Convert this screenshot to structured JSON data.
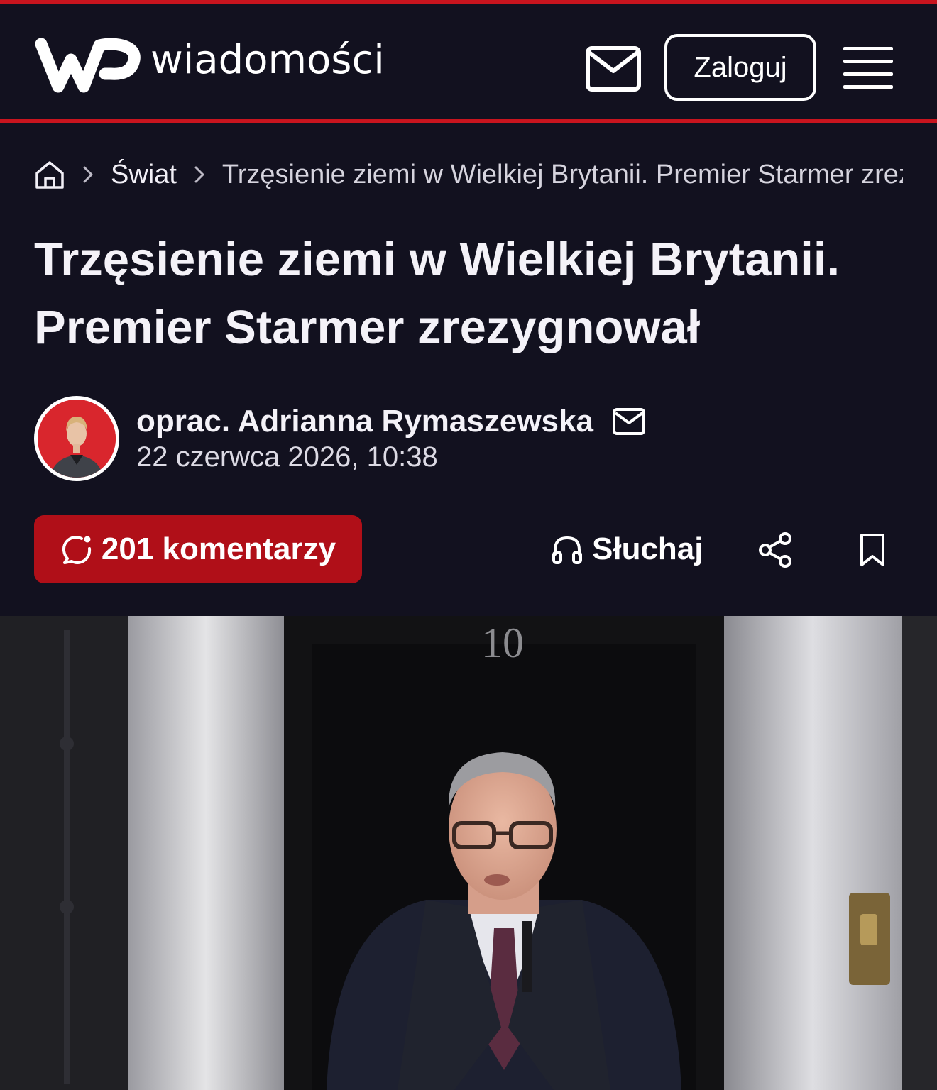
{
  "header": {
    "logo_text": "wiadomości",
    "login_label": "Zaloguj"
  },
  "breadcrumb": {
    "section": "Świat",
    "current": "Trzęsienie ziemi w Wielkiej Brytanii. Premier Starmer zrezygnował"
  },
  "article": {
    "title": "Trzęsienie ziemi w Wielkiej Brytanii. Premier Starmer zrezygnował",
    "author": "oprac. Adrianna Rymaszewska",
    "date": "22 czerwca 2026, 10:38"
  },
  "actions": {
    "comments_label": "201 komentarzy",
    "listen_label": "Słuchaj"
  },
  "photo": {
    "door_number": "10"
  },
  "colors": {
    "brand_red": "#c8141e",
    "comments_button": "#b00f18",
    "background": "#12111f"
  },
  "icons": [
    "mail-icon",
    "hamburger-menu-icon",
    "home-icon",
    "chevron-right-icon",
    "comment-icon",
    "headphones-icon",
    "share-icon",
    "bookmark-icon"
  ]
}
